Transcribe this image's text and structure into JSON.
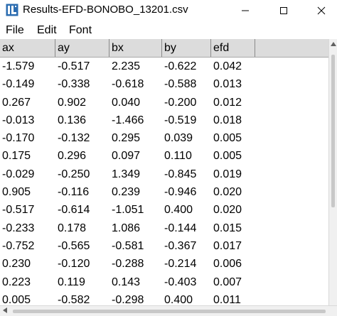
{
  "window": {
    "title": "Results-EFD-BONOBO_13201.csv",
    "controls": {
      "minimize": "–",
      "maximize": "☐",
      "close": "✕"
    }
  },
  "menu": {
    "items": [
      "File",
      "Edit",
      "Font"
    ]
  },
  "table": {
    "columns": [
      "ax",
      "ay",
      "bx",
      "by",
      "efd"
    ],
    "rows": [
      [
        "-1.579",
        "-0.517",
        "2.235",
        "-0.622",
        "0.042"
      ],
      [
        "-0.149",
        "-0.338",
        "-0.618",
        "-0.588",
        "0.013"
      ],
      [
        "0.267",
        "0.902",
        "0.040",
        "-0.200",
        "0.012"
      ],
      [
        "-0.013",
        "0.136",
        "-1.466",
        "-0.519",
        "0.018"
      ],
      [
        "-0.170",
        "-0.132",
        "0.295",
        "0.039",
        "0.005"
      ],
      [
        "0.175",
        "0.296",
        "0.097",
        "0.110",
        "0.005"
      ],
      [
        "-0.029",
        "-0.250",
        "1.349",
        "-0.845",
        "0.019"
      ],
      [
        "0.905",
        "-0.116",
        "0.239",
        "-0.946",
        "0.020"
      ],
      [
        "-0.517",
        "-0.614",
        "-1.051",
        "0.400",
        "0.020"
      ],
      [
        "-0.233",
        "0.178",
        "1.086",
        "-0.144",
        "0.015"
      ],
      [
        "-0.752",
        "-0.565",
        "-0.581",
        "-0.367",
        "0.017"
      ],
      [
        "0.230",
        "-0.120",
        "-0.288",
        "-0.214",
        "0.006"
      ],
      [
        "0.223",
        "0.119",
        "0.143",
        "-0.403",
        "0.007"
      ],
      [
        "0.005",
        "-0.582",
        "-0.298",
        "0.400",
        "0.011"
      ]
    ]
  },
  "icons": {
    "app": "imagej-window-icon",
    "scroll_up": "chevron-up-icon",
    "scroll_left": "chevron-left-icon"
  }
}
